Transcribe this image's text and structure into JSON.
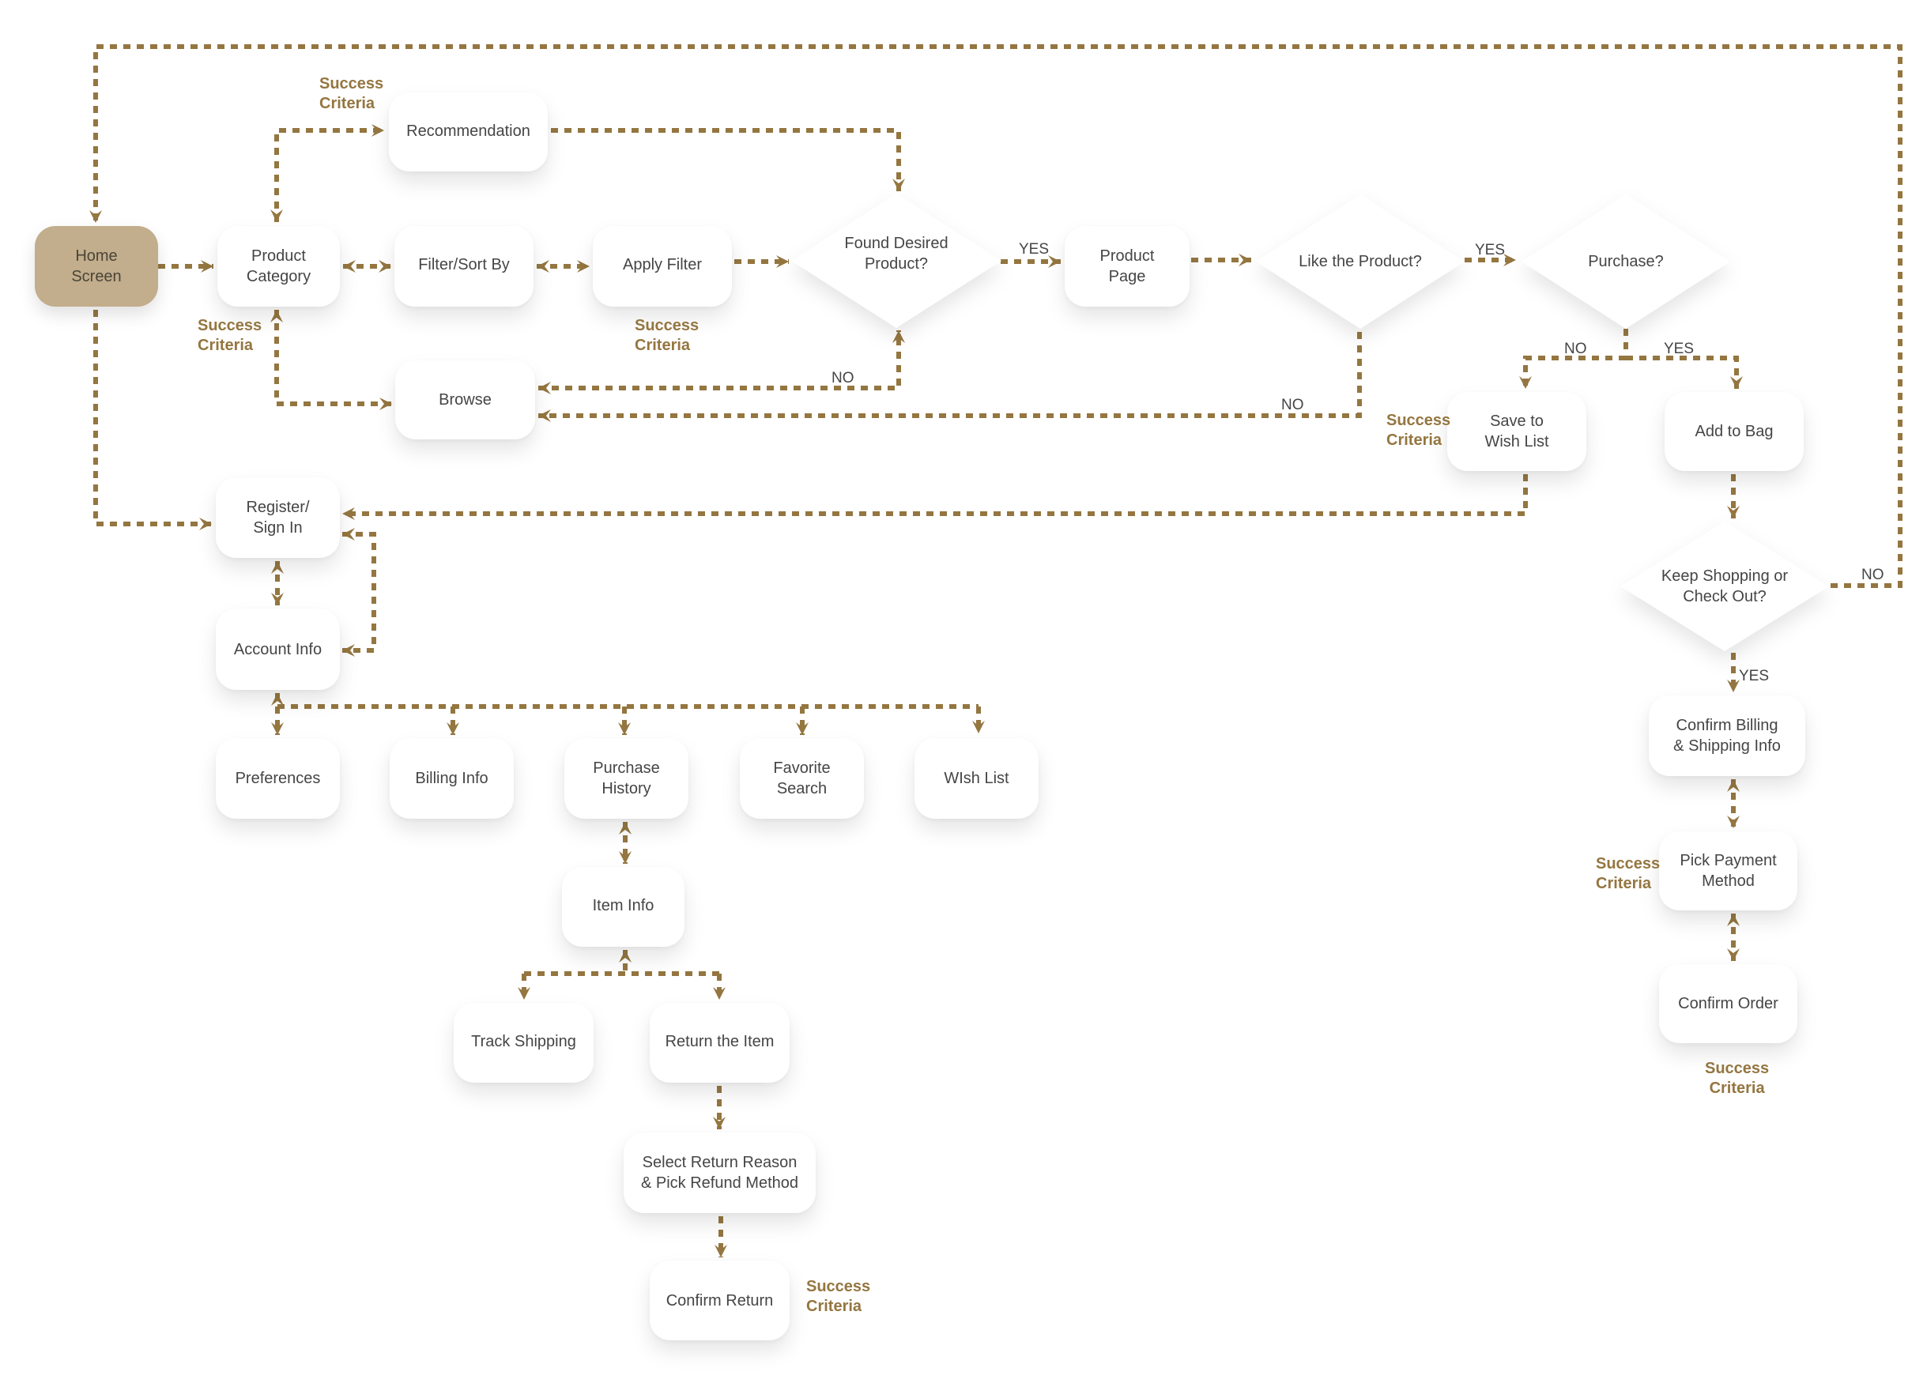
{
  "diagram": {
    "title": "E-commerce user flow",
    "colors": {
      "connector": "#947640",
      "start_node": "#c2ad8c",
      "node": "#ffffff",
      "node_text": "#454545",
      "success_text": "#947640"
    },
    "nodes": {
      "home": "Home\nScreen",
      "product_category": "Product\nCategory",
      "recommendation": "Recommendation",
      "filter_sort": "Filter/Sort By",
      "apply_filter": "Apply Filter",
      "browse": "Browse",
      "found_desired": "Found Desired\nProduct?",
      "product_page": "Product\nPage",
      "like_product": "Like the Product?",
      "purchase": "Purchase?",
      "save_wish_list": "Save to\nWish List",
      "add_to_bag": "Add to Bag",
      "keep_shopping": "Keep Shopping or\nCheck Out?",
      "confirm_billing": "Confirm Billing\n& Shipping Info",
      "pick_payment": "Pick Payment\nMethod",
      "confirm_order": "Confirm Order",
      "register": "Register/\nSign In",
      "account_info": "Account Info",
      "preferences": "Preferences",
      "billing_info": "Billing Info",
      "purchase_history": "Purchase\nHistory",
      "favorite_search": "Favorite\nSearch",
      "wish_list": "WIsh List",
      "item_info": "Item Info",
      "track_shipping": "Track Shipping",
      "return_item": "Return the Item",
      "select_return": "Select Return Reason\n& Pick Refund Method",
      "confirm_return": "Confirm Return"
    },
    "success_label": "Success\nCriteria",
    "edge_labels": {
      "found_yes": "YES",
      "found_no": "NO",
      "like_yes": "YES",
      "like_no": "NO",
      "purchase_no": "NO",
      "purchase_yes": "YES",
      "keep_no": "NO",
      "keep_yes": "YES"
    },
    "edges": [
      {
        "from": "home",
        "to": "product_category",
        "type": "arrow"
      },
      {
        "from": "product_category",
        "to": "recommendation",
        "type": "bidirectional"
      },
      {
        "from": "product_category",
        "to": "filter_sort",
        "type": "bidirectional"
      },
      {
        "from": "filter_sort",
        "to": "apply_filter",
        "type": "bidirectional"
      },
      {
        "from": "product_category",
        "to": "browse",
        "type": "bidirectional"
      },
      {
        "from": "recommendation",
        "to": "found_desired",
        "type": "arrow"
      },
      {
        "from": "apply_filter",
        "to": "found_desired",
        "type": "arrow"
      },
      {
        "from": "found_desired",
        "to": "product_page",
        "label": "YES",
        "type": "arrow"
      },
      {
        "from": "found_desired",
        "to": "browse",
        "label": "NO",
        "type": "bidirectional"
      },
      {
        "from": "product_page",
        "to": "like_product",
        "type": "arrow"
      },
      {
        "from": "like_product",
        "to": "purchase",
        "label": "YES",
        "type": "arrow"
      },
      {
        "from": "like_product",
        "to": "browse",
        "label": "NO",
        "type": "arrow"
      },
      {
        "from": "purchase",
        "to": "save_wish_list",
        "label": "NO",
        "type": "arrow"
      },
      {
        "from": "purchase",
        "to": "add_to_bag",
        "label": "YES",
        "type": "arrow"
      },
      {
        "from": "save_wish_list",
        "to": "register",
        "type": "arrow"
      },
      {
        "from": "add_to_bag",
        "to": "keep_shopping",
        "type": "arrow"
      },
      {
        "from": "keep_shopping",
        "to": "home",
        "label": "NO",
        "type": "arrow"
      },
      {
        "from": "keep_shopping",
        "to": "confirm_billing",
        "label": "YES",
        "type": "arrow"
      },
      {
        "from": "confirm_billing",
        "to": "pick_payment",
        "type": "bidirectional"
      },
      {
        "from": "pick_payment",
        "to": "confirm_order",
        "type": "bidirectional"
      },
      {
        "from": "home",
        "to": "register",
        "type": "arrow"
      },
      {
        "from": "register",
        "to": "account_info",
        "type": "bidirectional"
      },
      {
        "from": "account_info",
        "to": "register",
        "type": "arrow"
      },
      {
        "from": "account_info",
        "to": "preferences",
        "type": "bidirectional"
      },
      {
        "from": "account_info",
        "to": "billing_info",
        "type": "arrow"
      },
      {
        "from": "account_info",
        "to": "purchase_history",
        "type": "arrow"
      },
      {
        "from": "account_info",
        "to": "favorite_search",
        "type": "arrow"
      },
      {
        "from": "account_info",
        "to": "wish_list",
        "type": "arrow"
      },
      {
        "from": "purchase_history",
        "to": "item_info",
        "type": "bidirectional"
      },
      {
        "from": "item_info",
        "to": "track_shipping",
        "type": "arrow"
      },
      {
        "from": "item_info",
        "to": "return_item",
        "type": "arrow"
      },
      {
        "from": "return_item",
        "to": "select_return",
        "type": "arrow"
      },
      {
        "from": "select_return",
        "to": "confirm_return",
        "type": "arrow"
      }
    ]
  }
}
